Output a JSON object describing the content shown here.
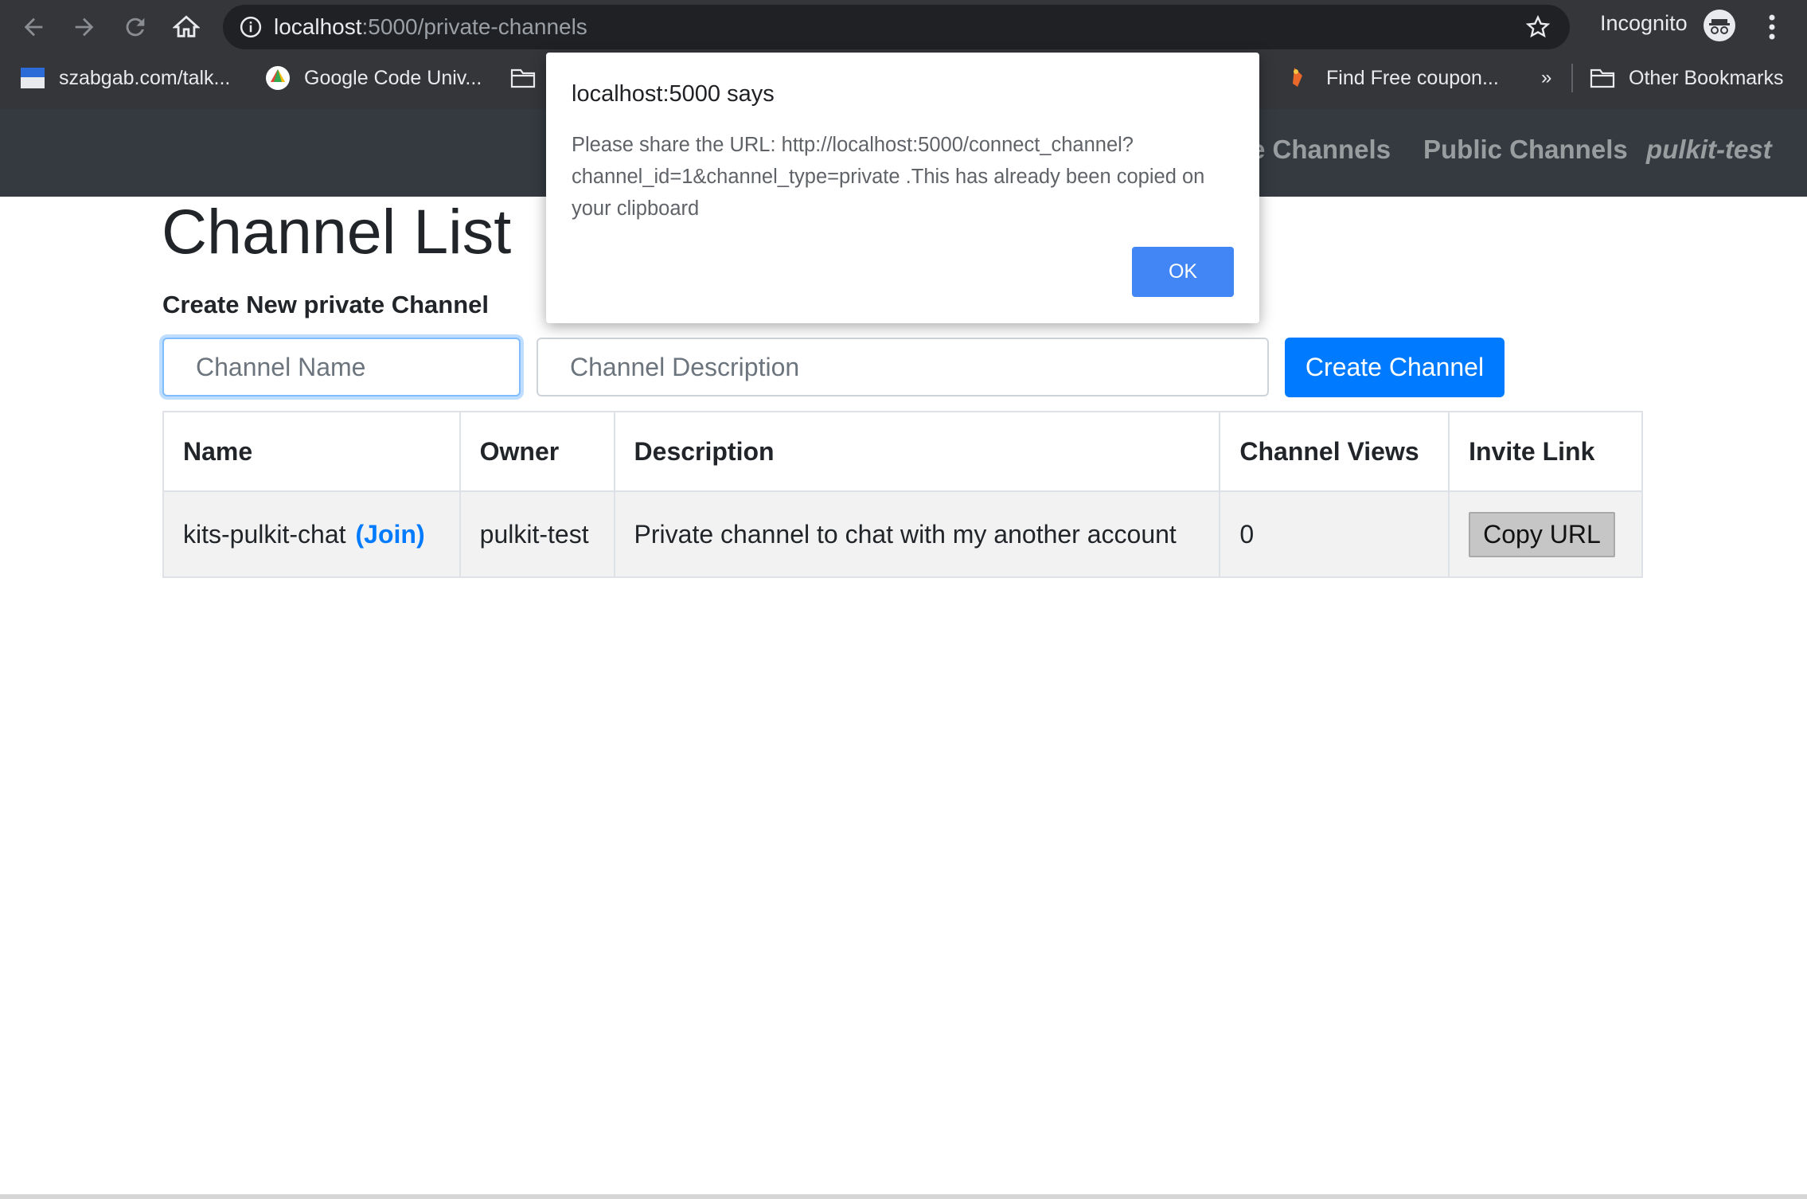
{
  "browser": {
    "url_host": "localhost",
    "url_path": ":5000/private-channels",
    "incognito_label": "Incognito",
    "bookmarks": [
      {
        "label": "szabgab.com/talk...",
        "icon": "site-favicon-icon"
      },
      {
        "label": "Google Code Univ...",
        "icon": "google-favicon-icon"
      },
      {
        "label": "",
        "icon": "folder-icon"
      },
      {
        "label": "Find Free coupon...",
        "icon": "coupon-favicon-icon"
      }
    ],
    "overflow_label": "»",
    "other_bookmarks_label": "Other Bookmarks"
  },
  "navbar": {
    "links": [
      "te Channels",
      "Public Channels",
      "pulkit-test"
    ]
  },
  "main": {
    "title": "Channel List",
    "subheading": "Create New private Channel",
    "name_placeholder": "Channel Name",
    "description_placeholder": "Channel Description",
    "create_label": "Create Channel"
  },
  "table": {
    "headers": [
      "Name",
      "Owner",
      "Description",
      "Channel Views",
      "Invite Link"
    ],
    "rows": [
      {
        "name": "kits-pulkit-chat",
        "join_label": "(Join)",
        "owner": "pulkit-test",
        "description": "Private channel to chat with my another account",
        "views": "0",
        "copy_label": "Copy URL"
      }
    ]
  },
  "dialog": {
    "title": "localhost:5000 says",
    "message": "Please share the URL: http://localhost:5000/connect_channel?channel_id=1&channel_type=private .This has already been copied on your clipboard",
    "ok_label": "OK"
  },
  "colors": {
    "primary": "#007bff",
    "navbar_bg": "#343a40",
    "chrome_bg": "#35363a",
    "dialog_ok": "#4285f4"
  }
}
